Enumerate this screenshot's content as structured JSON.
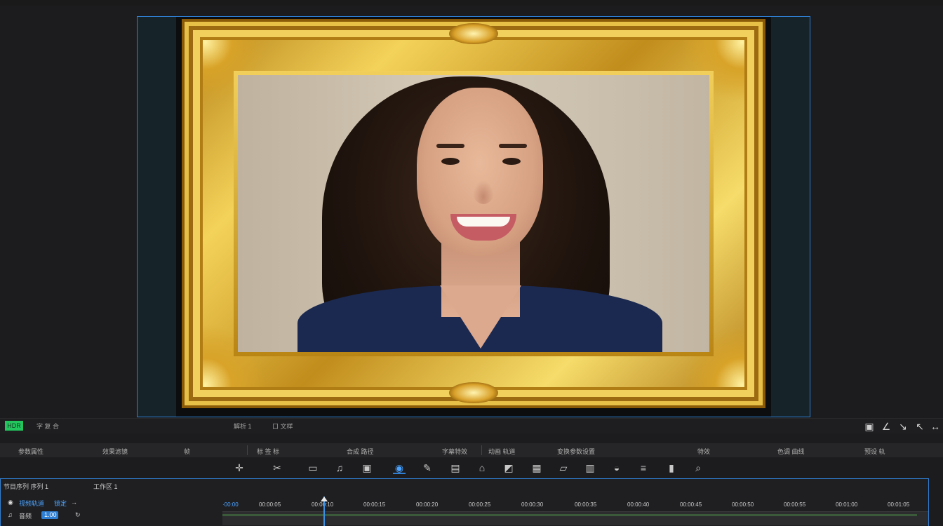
{
  "top_menu": [
    "",
    "",
    "",
    ""
  ],
  "viewer": {
    "label": "preview"
  },
  "row1": {
    "badge": "HDR",
    "left_text": "字 复 合",
    "mid1": "解析 1",
    "mid2": "口 文样"
  },
  "row2": {
    "t1": "参数属性",
    "t2": "效果滤镜",
    "t3": "帧",
    "t4": "标 签 标",
    "t5": "合成 路径",
    "t6": "字幕特效",
    "t7": "动画 轨道",
    "t8": "变换参数设置",
    "t9": "特效",
    "t10": "色调 曲线",
    "t11": "预设 轨"
  },
  "tools": [
    {
      "name": "move",
      "glyph": "✛"
    },
    {
      "name": "cut",
      "glyph": "✂"
    },
    {
      "name": "crop",
      "glyph": "▭"
    },
    {
      "name": "audio",
      "glyph": "♫"
    },
    {
      "name": "media",
      "glyph": "▣"
    },
    {
      "name": "effect",
      "glyph": "◉"
    },
    {
      "name": "paint",
      "glyph": "✎"
    },
    {
      "name": "text",
      "glyph": "▤"
    },
    {
      "name": "shape",
      "glyph": "⌂"
    },
    {
      "name": "mask",
      "glyph": "◩"
    },
    {
      "name": "grid",
      "glyph": "▦"
    },
    {
      "name": "speech",
      "glyph": "▱"
    },
    {
      "name": "book",
      "glyph": "▥"
    },
    {
      "name": "color",
      "glyph": "◒"
    },
    {
      "name": "bars",
      "glyph": "≡"
    },
    {
      "name": "export",
      "glyph": "▮"
    },
    {
      "name": "search",
      "glyph": "⌕"
    }
  ],
  "right_tools": [
    "▣",
    "∠",
    "↘",
    "↖",
    "↔"
  ],
  "timeline": {
    "tab1": "节目序列 序列 1",
    "tab2": "工作区 1",
    "track1_label": "视频轨道",
    "track1_extra": "锁定",
    "track2_label": "音频",
    "track2_value": "1.00",
    "ruler_start": "·00:00",
    "ticks": [
      "00:00:05",
      "00:00:10",
      "00:00:15",
      "00:00:20",
      "00:00:25",
      "00:00:30",
      "00:00:35",
      "00:00:40",
      "00:00:45",
      "00:00:50",
      "00:00:55",
      "00:01:00",
      "00:01:05"
    ]
  }
}
